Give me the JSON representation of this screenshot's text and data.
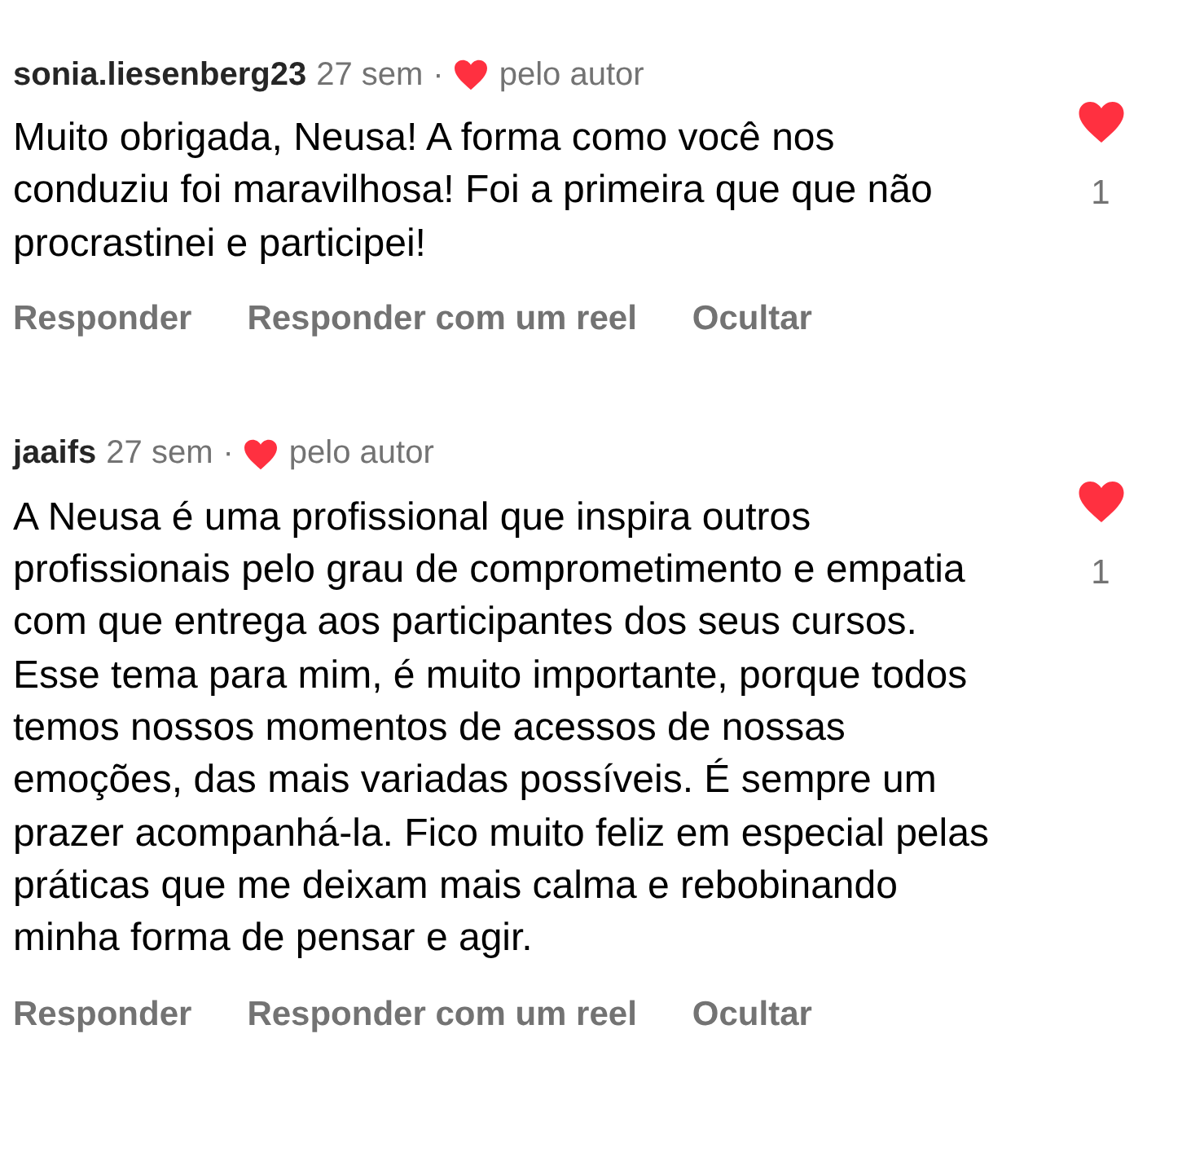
{
  "comments": [
    {
      "username": "sonia.liesenberg23",
      "time": "27 sem",
      "separator": "·",
      "author_like": "pelo autor",
      "text": "Muito obrigada,  Neusa!  A forma como você nos conduziu foi maravilhosa!  Foi a primeira que que não procrastinei e participei!",
      "liked": true,
      "like_count": "1",
      "actions": [
        "Responder",
        "Responder com um reel",
        "Ocultar"
      ]
    },
    {
      "username": "jaaifs",
      "time": "27 sem",
      "separator": "·",
      "author_like": "pelo autor",
      "text": "A Neusa é uma profissional que inspira outros profissionais pelo grau de comprometimento e empatia com que entrega aos participantes dos seus cursos. Esse tema para mim, é muito importante, porque todos temos nossos momentos de acessos de nossas emoções, das mais variadas possíveis. É sempre um prazer acompanhá-la. Fico muito feliz em especial pelas práticas que me deixam mais calma e rebobinando minha forma de pensar e agir.",
      "liked": true,
      "like_count": "1",
      "actions": [
        "Responder",
        "Responder com um reel",
        "Ocultar"
      ]
    }
  ]
}
